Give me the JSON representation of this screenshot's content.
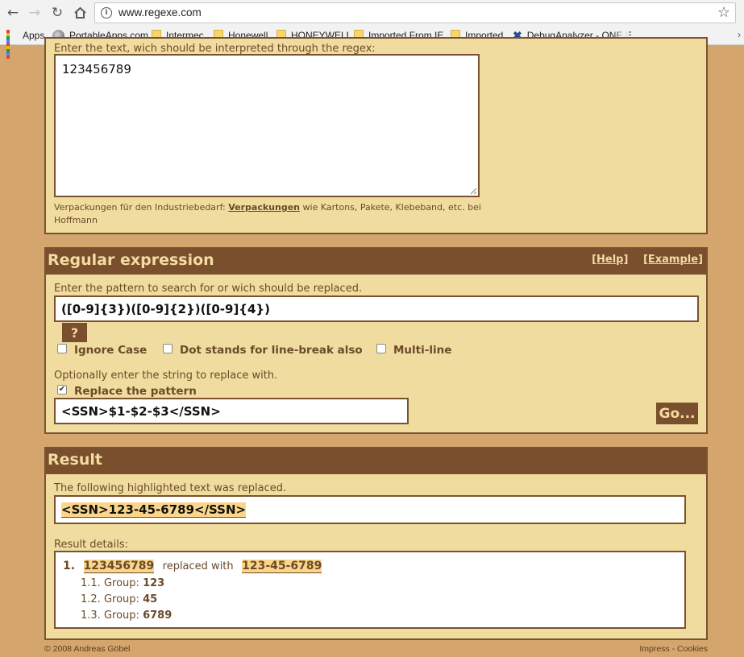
{
  "browser": {
    "url": "www.regexe.com",
    "bookmarks": [
      {
        "label": "Apps"
      },
      {
        "label": "PortableApps.com"
      },
      {
        "label": "Intermec"
      },
      {
        "label": "Honewell"
      },
      {
        "label": "HONEYWELL"
      },
      {
        "label": "Imported From IE"
      },
      {
        "label": "Imported"
      },
      {
        "label": "DebugAnalyzer - ONE E"
      }
    ]
  },
  "text_section": {
    "label": "Enter the text, wich should be interpreted through the regex:",
    "value": "123456789",
    "ad_prefix": "Verpackungen für den Industriebedarf: ",
    "ad_link": "Verpackungen",
    "ad_suffix": " wie Kartons, Pakete, Klebeband, etc. bei",
    "ad_line2": "Hoffmann"
  },
  "regex_section": {
    "title": "Regular expression",
    "help_link": "[Help]",
    "example_link": "[Example]",
    "pattern_label": "Enter the pattern to search for or wich should be replaced.",
    "pattern_value": "([0-9]{3})([0-9]{2})([0-9]{4})",
    "help_button": "?",
    "options": [
      {
        "label": "Ignore Case",
        "checked": false
      },
      {
        "label": "Dot stands for line-break also",
        "checked": false
      },
      {
        "label": "Multi-line",
        "checked": false
      }
    ],
    "replace_hint": "Optionally enter the string to replace with.",
    "replace_checkbox_label": "Replace the pattern",
    "replace_checked": true,
    "replace_value": "<SSN>$1-$2-$3</SSN>",
    "go_button": "Go..."
  },
  "result_section": {
    "title": "Result",
    "summary_label": "The following highlighted text was replaced.",
    "result_value": "<SSN>123-45-6789</SSN>",
    "details_label": "Result details:",
    "match_index": "1.",
    "match_original": "123456789",
    "replaced_with": "replaced with",
    "match_replacement": "123-45-6789",
    "groups": [
      {
        "index": "1.1.",
        "label": "Group:",
        "value": "123"
      },
      {
        "index": "1.2.",
        "label": "Group:",
        "value": "45"
      },
      {
        "index": "1.3.",
        "label": "Group:",
        "value": "6789"
      }
    ]
  },
  "footer": {
    "copyright": "© 2008 Andreas Göbel",
    "links": "Impress - Cookies"
  }
}
